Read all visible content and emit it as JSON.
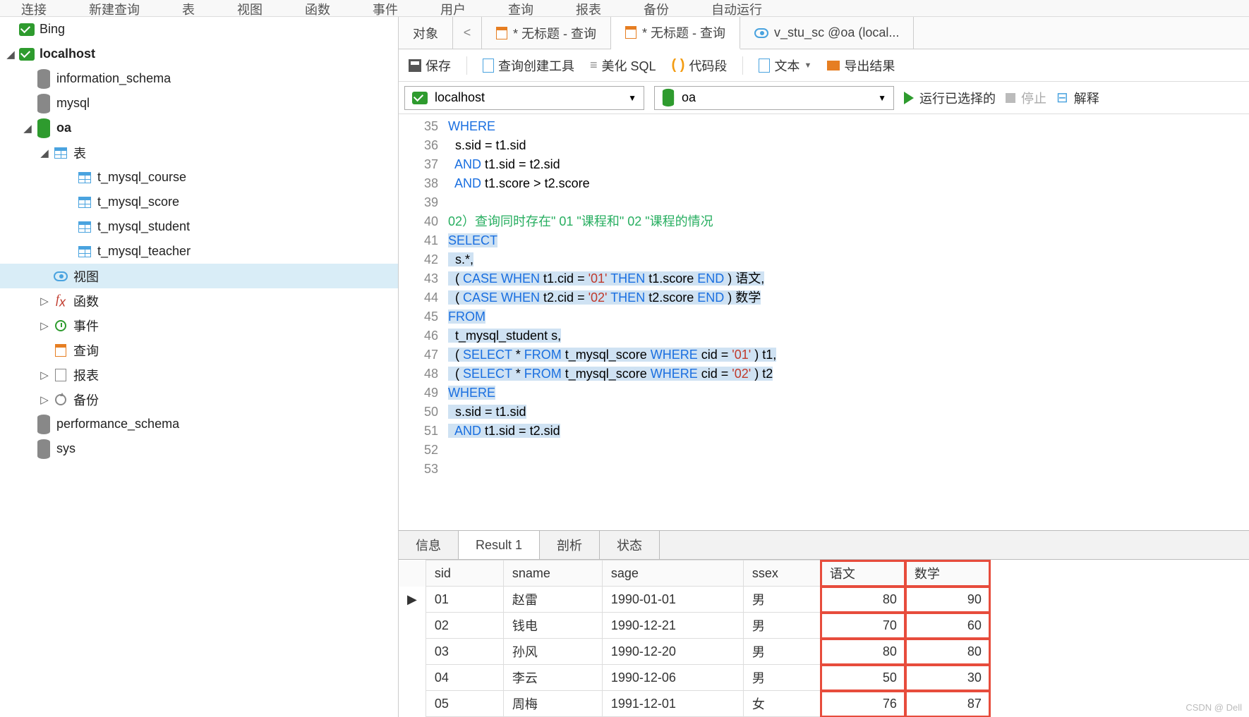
{
  "menubar": [
    "连接",
    "新建查询",
    "表",
    "视图",
    "函数",
    "事件",
    "用户",
    "查询",
    "报表",
    "备份",
    "自动运行"
  ],
  "sidebar": {
    "conn1": "Bing",
    "conn2": "localhost",
    "dbs_a": [
      "information_schema",
      "mysql"
    ],
    "db_oa": "oa",
    "tables_label": "表",
    "tables": [
      "t_mysql_course",
      "t_mysql_score",
      "t_mysql_student",
      "t_mysql_teacher"
    ],
    "views": "视图",
    "funcs": "函数",
    "events": "事件",
    "queries": "查询",
    "reports": "报表",
    "backup": "备份",
    "dbs_b": [
      "performance_schema",
      "sys"
    ]
  },
  "tabs": {
    "objects": "对象",
    "q1": "* 无标题 - 查询",
    "q2": "* 无标题 - 查询",
    "v": "v_stu_sc @oa (local..."
  },
  "toolbar": {
    "save": "保存",
    "builder": "查询创建工具",
    "beautify": "美化 SQL",
    "snippet": "代码段",
    "text": "文本",
    "export": "导出结果"
  },
  "connrow": {
    "host": "localhost",
    "db": "oa",
    "run": "运行已选择的",
    "stop": "停止",
    "explain": "解释"
  },
  "code": {
    "start": 35,
    "lines": [
      {
        "t": "WHERE",
        "cls": "kw"
      },
      {
        "t": "  s.sid = t1.sid"
      },
      {
        "t": "  AND t1.sid = t2.sid",
        "kwpre": "  ",
        "kw": "AND",
        "post": " t1.sid = t2.sid"
      },
      {
        "t": "  AND t1.score > t2.score",
        "kwpre": "  ",
        "kw": "AND",
        "post": " t1.score > t2.score"
      },
      {
        "t": ""
      },
      {
        "cmt": "02）查询同时存在\" 01 \"课程和\" 02 \"课程的情况"
      },
      {
        "sel": true,
        "raw": "SELECT"
      },
      {
        "sel": true,
        "raw": "  s.*,"
      },
      {
        "sel": true,
        "raw": "  ( CASE WHEN t1.cid = '01' THEN t1.score END ) 语文,"
      },
      {
        "sel": true,
        "raw": "  ( CASE WHEN t2.cid = '02' THEN t2.score END ) 数学"
      },
      {
        "sel": true,
        "raw": "FROM"
      },
      {
        "sel": true,
        "raw": "  t_mysql_student s,"
      },
      {
        "sel": true,
        "raw": "  ( SELECT * FROM t_mysql_score WHERE cid = '01' ) t1,"
      },
      {
        "sel": true,
        "raw": "  ( SELECT * FROM t_mysql_score WHERE cid = '02' ) t2"
      },
      {
        "sel": true,
        "raw": "WHERE"
      },
      {
        "sel": true,
        "raw": "  s.sid = t1.sid"
      },
      {
        "sel": true,
        "raw": "  AND t1.sid = t2.sid"
      },
      {
        "t": ""
      },
      {
        "t": ""
      }
    ]
  },
  "rtabs": {
    "info": "信息",
    "result": "Result 1",
    "profile": "剖析",
    "status": "状态"
  },
  "result": {
    "headers": [
      "sid",
      "sname",
      "sage",
      "ssex",
      "语文",
      "数学"
    ],
    "rows": [
      [
        "01",
        "赵雷",
        "1990-01-01",
        "男",
        "80",
        "90"
      ],
      [
        "02",
        "钱电",
        "1990-12-21",
        "男",
        "70",
        "60"
      ],
      [
        "03",
        "孙风",
        "1990-12-20",
        "男",
        "80",
        "80"
      ],
      [
        "04",
        "李云",
        "1990-12-06",
        "男",
        "50",
        "30"
      ],
      [
        "05",
        "周梅",
        "1991-12-01",
        "女",
        "76",
        "87"
      ]
    ]
  },
  "watermark": "CSDN @ Dell"
}
